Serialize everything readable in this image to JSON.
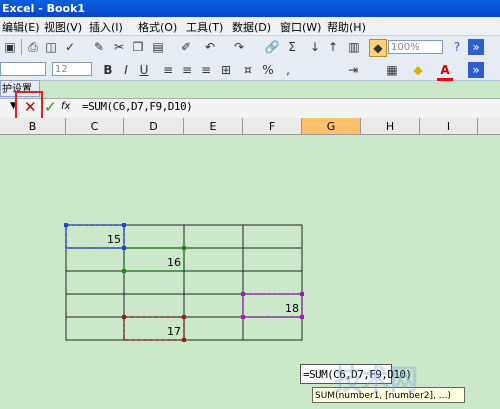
{
  "window": {
    "title": "Excel - Book1"
  },
  "menu": [
    "编辑(E)",
    "视图(V)",
    "插入(I)",
    "格式(O)",
    "工具(T)",
    "数据(D)",
    "窗口(W)",
    "帮助(H)"
  ],
  "toolbar": {
    "zoom": "100%",
    "font_size": "12"
  },
  "taskpane": {
    "label": "护设置"
  },
  "formula_bar": {
    "formula": "=SUM(C6,D7,F9,D10)",
    "fx": "fx"
  },
  "columns": [
    "B",
    "C",
    "D",
    "E",
    "F",
    "G",
    "H",
    "I"
  ],
  "selected_column": "G",
  "cells": {
    "C6": "15",
    "D7": "16",
    "F9": "18",
    "D10": "17"
  },
  "tooltip": {
    "edit": "=SUM(C6,D7,F9,D10)",
    "hint": "SUM(number1, [number2], ...)"
  },
  "watermark": "技术网",
  "colors": {
    "grid_bg": "#cbe8cb",
    "titlebar": "#0a5fe0",
    "cancel_box": "#e32020"
  }
}
